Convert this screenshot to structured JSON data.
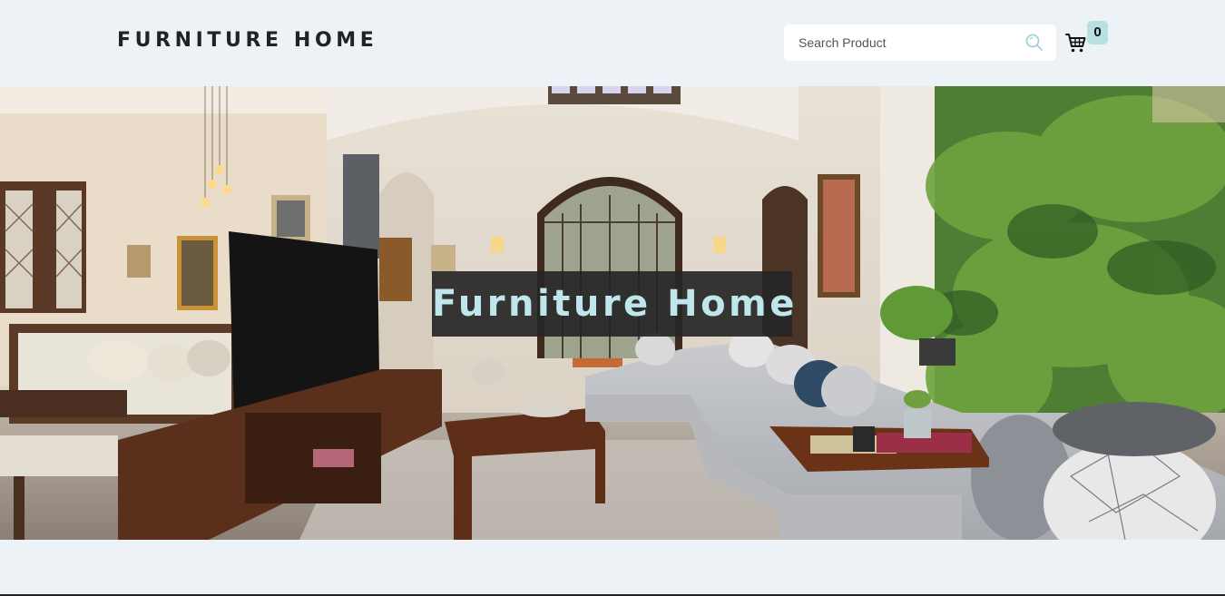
{
  "header": {
    "logo": "FURNITURE HOME",
    "search": {
      "placeholder": "Search Product",
      "value": "",
      "icon": "search-icon"
    },
    "cart": {
      "icon": "cart-icon",
      "count": "0"
    }
  },
  "hero": {
    "title": "Furniture Home",
    "image": "living-room-photo"
  },
  "colors": {
    "background": "#edf2f7",
    "accent": "#b8e0e0",
    "hero_title": "#bfe6ea",
    "title_box": "#262626"
  }
}
